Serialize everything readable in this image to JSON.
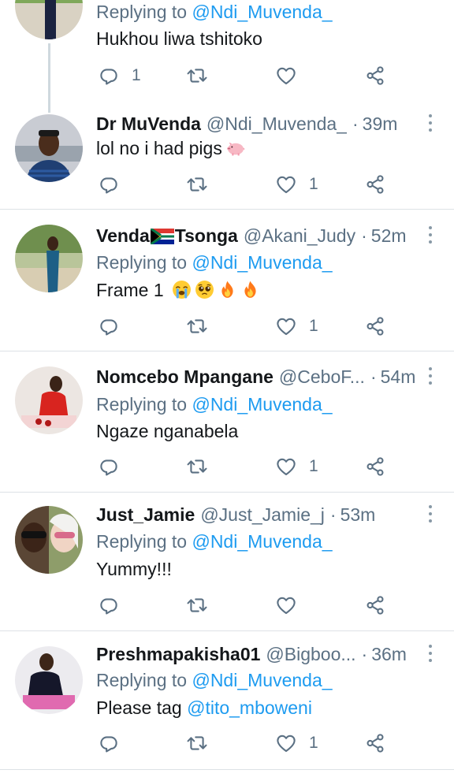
{
  "tweets": [
    {
      "reply_prefix": "Replying to ",
      "reply_to": "@Ndi_Muvenda_",
      "text": "Hukhou liwa tshitoko",
      "reply_count": "1",
      "like_count": ""
    },
    {
      "name": "Dr MuVenda",
      "handle": "@Ndi_Muvenda_",
      "time": "39m",
      "text": "lol no i had pigs",
      "reply_count": "",
      "like_count": "1"
    },
    {
      "name_part1": "Venda",
      "name_part2": "Tsonga",
      "handle": "@Akani_Judy",
      "time": "52m",
      "reply_prefix": "Replying to ",
      "reply_to": "@Ndi_Muvenda_",
      "text": "Frame 1",
      "reply_count": "",
      "like_count": "1"
    },
    {
      "name": "Nomcebo Mpangane",
      "handle": "@CeboF...",
      "time": "54m",
      "reply_prefix": "Replying to ",
      "reply_to": "@Ndi_Muvenda_",
      "text": "Ngaze nganabela",
      "reply_count": "",
      "like_count": "1"
    },
    {
      "name": "Just_Jamie",
      "handle": "@Just_Jamie_j",
      "time": "53m",
      "reply_prefix": "Replying to ",
      "reply_to": "@Ndi_Muvenda_",
      "text": "Yummy!!!",
      "reply_count": "",
      "like_count": ""
    },
    {
      "name": "Preshmapakisha01",
      "handle": "@Bigboo...",
      "time": "36m",
      "reply_prefix": "Replying to ",
      "reply_to": "@Ndi_Muvenda_",
      "text_prefix": "Please tag ",
      "text_mention": "@tito_mboweni",
      "reply_count": "",
      "like_count": "1"
    }
  ],
  "separator": "·",
  "icons": {
    "reply": "reply-icon",
    "retweet": "retweet-icon",
    "like": "heart-icon",
    "share": "share-icon",
    "more": "more-vertical-icon",
    "flag": "south-africa-flag-icon",
    "pig": "pig-emoji",
    "crying": "loudly-crying-face-emoji",
    "pleading": "pleading-face-emoji",
    "fire": "fire-emoji"
  },
  "colors": {
    "link": "#1d9bf0",
    "secondary_text": "#5b7083",
    "divider": "#dde2e6"
  }
}
